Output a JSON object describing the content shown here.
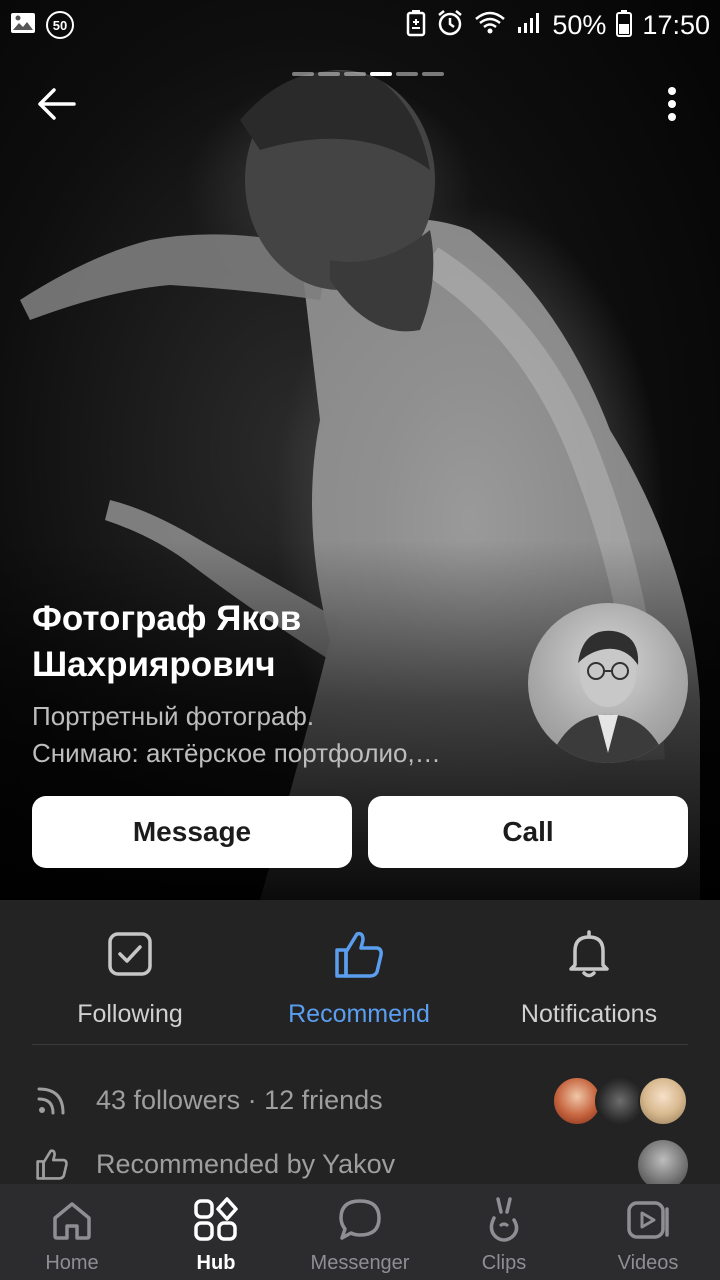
{
  "status_bar": {
    "notif_badge": "50",
    "battery_percent": "50%",
    "time": "17:50"
  },
  "profile": {
    "name": "Фотограф Яков Шахриярович",
    "description_line1": "Портретный фотограф.",
    "description_line2": "Снимаю: актёрское портфолио,…"
  },
  "actions": {
    "message": "Message",
    "call": "Call"
  },
  "quick_actions": [
    {
      "label": "Following",
      "icon": "checkbox-icon"
    },
    {
      "label": "Recommend",
      "icon": "thumbs-up-icon",
      "color": "#5b9ef0"
    },
    {
      "label": "Notifications",
      "icon": "bell-icon"
    }
  ],
  "info": {
    "followers": "43 followers · 12 friends",
    "recommended": "Recommended by Yakov"
  },
  "bottom_nav": [
    {
      "label": "Home",
      "icon": "home-icon"
    },
    {
      "label": "Hub",
      "icon": "hub-icon",
      "active": true
    },
    {
      "label": "Messenger",
      "icon": "messenger-icon"
    },
    {
      "label": "Clips",
      "icon": "clips-icon"
    },
    {
      "label": "Videos",
      "icon": "videos-icon"
    }
  ],
  "colors": {
    "accent": "#5b9ef0",
    "panel_bg": "#232324",
    "nav_bg": "#2c2c2e"
  }
}
